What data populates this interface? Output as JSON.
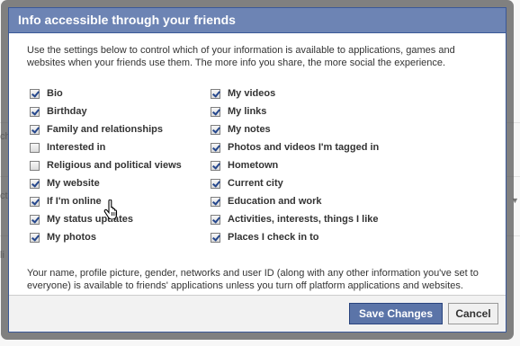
{
  "dialog": {
    "title": "Info accessible through your friends",
    "intro": "Use the settings below to control which of your information is available to applications, games and websites when your friends use them. The more info you share, the more social the experience.",
    "note": "Your name, profile picture, gender, networks and user ID (along with any other information you've set to everyone) is available to friends' applications unless you turn off platform applications and websites."
  },
  "options": {
    "left": [
      {
        "label": "Bio",
        "checked": true
      },
      {
        "label": "Birthday",
        "checked": true
      },
      {
        "label": "Family and relationships",
        "checked": true
      },
      {
        "label": "Interested in",
        "checked": false
      },
      {
        "label": "Religious and political views",
        "checked": false
      },
      {
        "label": "My website",
        "checked": true
      },
      {
        "label": "If I'm online",
        "checked": true
      },
      {
        "label": "My status updates",
        "checked": true
      },
      {
        "label": "My photos",
        "checked": true
      }
    ],
    "right": [
      {
        "label": "My videos",
        "checked": true
      },
      {
        "label": "My links",
        "checked": true
      },
      {
        "label": "My notes",
        "checked": true
      },
      {
        "label": "Photos and videos I'm tagged in",
        "checked": true
      },
      {
        "label": "Hometown",
        "checked": true
      },
      {
        "label": "Current city",
        "checked": true
      },
      {
        "label": "Education and work",
        "checked": true
      },
      {
        "label": "Activities, interests, things I like",
        "checked": true
      },
      {
        "label": "Places I check in to",
        "checked": true
      }
    ]
  },
  "buttons": {
    "save": "Save Changes",
    "cancel": "Cancel"
  },
  "background": {
    "fragment_1": "ch",
    "fragment_2": "ct",
    "fragment_3": "li"
  },
  "colors": {
    "title_bar": "#6d84b4",
    "border": "#3b5998",
    "primary_button": "#5b74a8",
    "checkmark": "#25478c"
  },
  "icons": {
    "cursor": "hand-pointer-icon",
    "checkbox": "checkbox-icon",
    "dropdown": "dropdown-arrow-icon"
  }
}
